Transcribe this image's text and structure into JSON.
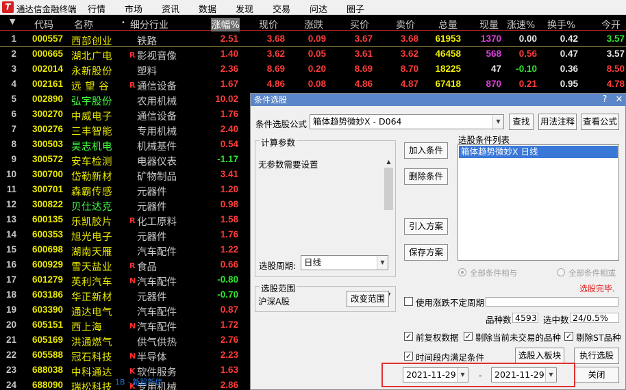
{
  "app": {
    "title": "通达信金融终端",
    "logo": "T",
    "menu": [
      "行情",
      "市场",
      "资讯",
      "数据",
      "发现",
      "交易",
      "问达",
      "圈子"
    ]
  },
  "table": {
    "headers": [
      "代码",
      "名称",
      "细分行业",
      "涨幅%",
      "现价",
      "涨跌",
      "买价",
      "卖价",
      "总量",
      "现量",
      "涨速%",
      "换手%",
      "今开"
    ],
    "sort_arrow": "▼",
    "name_dot": "•",
    "rows": [
      {
        "idx": "1",
        "code": "000557",
        "name": "西部创业",
        "flag": "",
        "ind": "铁路",
        "chg": "2.51",
        "price": "3.68",
        "diff": "0.09",
        "bid": "3.67",
        "ask": "3.68",
        "vol": "61953",
        "cur": "1370",
        "spd": "0.00",
        "turn": "0.42",
        "open": "3.57"
      },
      {
        "idx": "2",
        "code": "000665",
        "name": "湖北广电",
        "flag": "R",
        "ind": "影视音像",
        "chg": "1.40",
        "price": "3.62",
        "diff": "0.05",
        "bid": "3.61",
        "ask": "3.62",
        "vol": "46458",
        "cur": "568",
        "spd": "0.56",
        "turn": "0.47",
        "open": "3.57"
      },
      {
        "idx": "3",
        "code": "002014",
        "name": "永新股份",
        "flag": "",
        "ind": "塑料",
        "chg": "2.36",
        "price": "8.69",
        "diff": "0.20",
        "bid": "8.69",
        "ask": "8.70",
        "vol": "18225",
        "cur": "47",
        "spd": "-0.10",
        "turn": "0.36",
        "open": "8.50"
      },
      {
        "idx": "4",
        "code": "002161",
        "name": "远 望 谷",
        "flag": "R",
        "ind": "通信设备",
        "chg": "1.67",
        "price": "4.86",
        "diff": "0.08",
        "bid": "4.86",
        "ask": "4.87",
        "vol": "67418",
        "cur": "870",
        "spd": "0.21",
        "turn": "0.95",
        "open": "4.78"
      },
      {
        "idx": "5",
        "code": "002890",
        "name": "弘宇股份",
        "flag": "",
        "ind": "农用机械",
        "chg": "10.02",
        "price": "",
        "diff": "",
        "bid": "",
        "ask": "",
        "vol": "",
        "cur": "",
        "spd": "",
        "turn": "",
        "open": ""
      },
      {
        "idx": "6",
        "code": "300270",
        "name": "中威电子",
        "flag": "",
        "ind": "通信设备",
        "chg": "1.76",
        "price": "",
        "diff": "",
        "bid": "",
        "ask": "",
        "vol": "",
        "cur": "",
        "spd": "",
        "turn": "",
        "open": ""
      },
      {
        "idx": "7",
        "code": "300276",
        "name": "三丰智能",
        "flag": "",
        "ind": "专用机械",
        "chg": "2.40",
        "price": "",
        "diff": "",
        "bid": "",
        "ask": "",
        "vol": "",
        "cur": "",
        "spd": "",
        "turn": "",
        "open": ""
      },
      {
        "idx": "8",
        "code": "300503",
        "name": "昊志机电",
        "flag": "",
        "ind": "机械基件",
        "chg": "0.54",
        "price": "",
        "diff": "",
        "bid": "",
        "ask": "",
        "vol": "",
        "cur": "",
        "spd": "",
        "turn": "",
        "open": ""
      },
      {
        "idx": "9",
        "code": "300572",
        "name": "安车检测",
        "flag": "",
        "ind": "电器仪表",
        "chg": "-1.17",
        "price": "",
        "diff": "",
        "bid": "",
        "ask": "",
        "vol": "",
        "cur": "",
        "spd": "",
        "turn": "",
        "open": ""
      },
      {
        "idx": "10",
        "code": "300700",
        "name": "岱勒新材",
        "flag": "",
        "ind": "矿物制品",
        "chg": "3.41",
        "price": "",
        "diff": "",
        "bid": "",
        "ask": "",
        "vol": "",
        "cur": "",
        "spd": "",
        "turn": "",
        "open": ""
      },
      {
        "idx": "11",
        "code": "300701",
        "name": "森霸传感",
        "flag": "",
        "ind": "元器件",
        "chg": "1.20",
        "price": "",
        "diff": "",
        "bid": "",
        "ask": "",
        "vol": "",
        "cur": "",
        "spd": "",
        "turn": "",
        "open": ""
      },
      {
        "idx": "12",
        "code": "300822",
        "name": "贝仕达克",
        "flag": "",
        "ind": "元器件",
        "chg": "0.98",
        "price": "",
        "diff": "",
        "bid": "",
        "ask": "",
        "vol": "",
        "cur": "",
        "spd": "",
        "turn": "",
        "open": ""
      },
      {
        "idx": "13",
        "code": "600135",
        "name": "乐凯胶片",
        "flag": "R",
        "ind": "化工原料",
        "chg": "1.58",
        "price": "",
        "diff": "",
        "bid": "",
        "ask": "",
        "vol": "",
        "cur": "",
        "spd": "",
        "turn": "",
        "open": ""
      },
      {
        "idx": "14",
        "code": "600353",
        "name": "旭光电子",
        "flag": "",
        "ind": "元器件",
        "chg": "1.76",
        "price": "",
        "diff": "",
        "bid": "",
        "ask": "",
        "vol": "",
        "cur": "",
        "spd": "",
        "turn": "",
        "open": ""
      },
      {
        "idx": "15",
        "code": "600698",
        "name": "湖南天雁",
        "flag": "",
        "ind": "汽车配件",
        "chg": "1.22",
        "price": "",
        "diff": "",
        "bid": "",
        "ask": "",
        "vol": "",
        "cur": "",
        "spd": "",
        "turn": "",
        "open": ""
      },
      {
        "idx": "16",
        "code": "600929",
        "name": "雪天盐业",
        "flag": "R",
        "ind": "食品",
        "chg": "0.66",
        "price": "",
        "diff": "",
        "bid": "",
        "ask": "",
        "vol": "",
        "cur": "",
        "spd": "",
        "turn": "",
        "open": ""
      },
      {
        "idx": "17",
        "code": "601279",
        "name": "英利汽车",
        "flag": "N",
        "ind": "汽车配件",
        "chg": "-0.80",
        "price": "",
        "diff": "",
        "bid": "",
        "ask": "",
        "vol": "",
        "cur": "",
        "spd": "",
        "turn": "",
        "open": ""
      },
      {
        "idx": "18",
        "code": "603186",
        "name": "华正新材",
        "flag": "",
        "ind": "元器件",
        "chg": "-0.70",
        "price": "",
        "diff": "",
        "bid": "",
        "ask": "",
        "vol": "",
        "cur": "",
        "spd": "",
        "turn": "",
        "open": ""
      },
      {
        "idx": "19",
        "code": "603390",
        "name": "通达电气",
        "flag": "",
        "ind": "汽车配件",
        "chg": "0.87",
        "price": "",
        "diff": "",
        "bid": "",
        "ask": "",
        "vol": "",
        "cur": "",
        "spd": "",
        "turn": "",
        "open": ""
      },
      {
        "idx": "20",
        "code": "605151",
        "name": "西上海",
        "flag": "N",
        "ind": "汽车配件",
        "chg": "1.72",
        "price": "",
        "diff": "",
        "bid": "",
        "ask": "",
        "vol": "",
        "cur": "",
        "spd": "",
        "turn": "",
        "open": ""
      },
      {
        "idx": "21",
        "code": "605169",
        "name": "洪通燃气",
        "flag": "",
        "ind": "供气供热",
        "chg": "2.76",
        "price": "",
        "diff": "",
        "bid": "",
        "ask": "",
        "vol": "",
        "cur": "",
        "spd": "",
        "turn": "",
        "open": ""
      },
      {
        "idx": "22",
        "code": "605588",
        "name": "冠石科技",
        "flag": "N",
        "ind": "半导体",
        "chg": "2.23",
        "price": "",
        "diff": "",
        "bid": "",
        "ask": "",
        "vol": "",
        "cur": "",
        "spd": "",
        "turn": "",
        "open": ""
      },
      {
        "idx": "23",
        "code": "688038",
        "name": "中科通达",
        "flag": "K",
        "ind": "软件服务",
        "chg": "1.63",
        "price": "",
        "diff": "",
        "bid": "",
        "ask": "",
        "vol": "",
        "cur": "",
        "spd": "",
        "turn": "",
        "open": ""
      },
      {
        "idx": "24",
        "code": "688090",
        "name": "瑞松科技",
        "flag": "K",
        "ind": "专用机械",
        "chg": "2.86",
        "price": "",
        "diff": "",
        "bid": "",
        "ask": "",
        "vol": "",
        "cur": "",
        "spd": "",
        "turn": "",
        "open": ""
      }
    ],
    "green_name_rows": [
      4,
      7,
      11
    ],
    "colors": {
      "up": "#ff3c3c",
      "down": "#30e830",
      "code": "#e8e800",
      "volume": "#f0f000",
      "cur_volume": "#e040e0"
    }
  },
  "status_overlay": "1B - 新股新债",
  "dialog": {
    "title": "条件选股",
    "help_icon": "?",
    "close_icon": "✕",
    "formula_label": "条件选股公式",
    "formula_value": "箱体趋势微妙X  -  D064",
    "btn_find": "查找",
    "btn_usage": "用法注释",
    "btn_view": "查看公式",
    "params_group": "计算参数",
    "params_text": "无参数需要设置",
    "period_label": "选股周期:",
    "period_value": "日线",
    "btn_add": "加入条件",
    "btn_delete": "删除条件",
    "btn_import": "引入方案",
    "btn_save": "保存方案",
    "list_title": "选股条件列表",
    "list_items": [
      "箱体趋势微妙X  日线"
    ],
    "radio_and": "全部条件相与",
    "radio_or": "全部条件相或",
    "status_done": "选股完毕.",
    "range_group": "选股范围",
    "range_value": "沪深A股",
    "btn_change_range": "改变范围",
    "chk_uncertain_label": "使用涨跌不定周期",
    "stock_count_label": "品种数",
    "stock_count": "4593",
    "selected_label": "选中数",
    "selected_value": "24/0.5%",
    "chk_fq_label": "前复权数据",
    "chk_exclude_label": "剔除当前未交易的品种",
    "chk_st_label": "剔除ST品种",
    "chk_period_label": "时间段内满足条件",
    "btn_to_block": "选股入板块",
    "btn_execute": "执行选股",
    "date_from": "2021-11-29",
    "date_to": "2021-11-29",
    "date_sep": "-",
    "btn_close": "关闭",
    "check_mark": "✓",
    "dropdown_arrow": "▼",
    "scroll_up": "▲",
    "scroll_down": "▼",
    "highlight_color": "#e03030",
    "title_color": "#5b87c8"
  }
}
